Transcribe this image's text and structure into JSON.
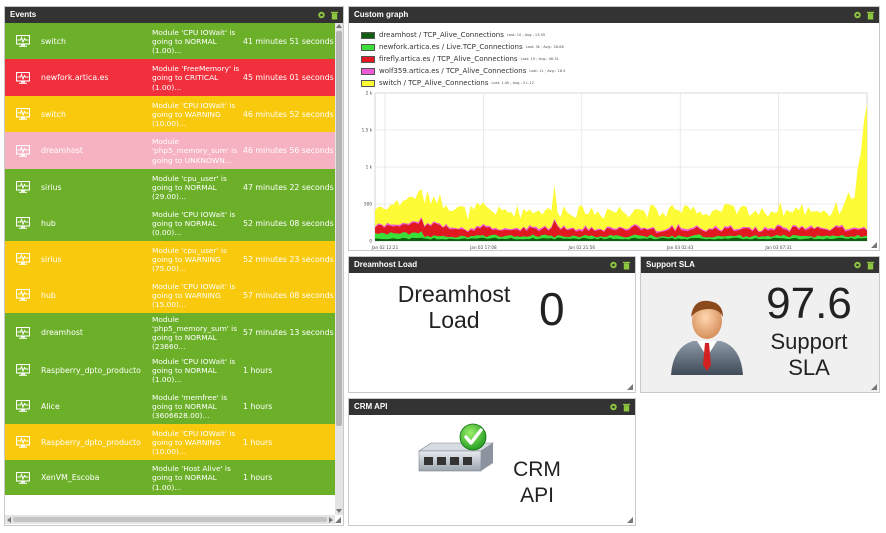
{
  "events": {
    "title": "Events",
    "rows": [
      {
        "agent": "switch",
        "message": "Module 'CPU IOWait' is going to NORMAL (1.00)...",
        "time": "41 minutes 51 seconds",
        "status": "normal"
      },
      {
        "agent": "newfork.artica.es",
        "message": "Module 'FreeMemory' is going to CRITICAL (1.00)...",
        "time": "45 minutes 01 seconds",
        "status": "critical"
      },
      {
        "agent": "switch",
        "message": "Module 'CPU IOWait' is going to WARNING (10.00)...",
        "time": "46 minutes 52 seconds",
        "status": "warning"
      },
      {
        "agent": "dreamhost",
        "message": "Module 'php5_memory_sum' is going to UNKNOWN...",
        "time": "46 minutes 56 seconds",
        "status": "unknown"
      },
      {
        "agent": "sirius",
        "message": "Module 'cpu_user' is going to NORMAL (29.00)...",
        "time": "47 minutes 22 seconds",
        "status": "normal"
      },
      {
        "agent": "hub",
        "message": "Module 'CPU IOWait' is going to NORMAL (0.00)...",
        "time": "52 minutes 08 seconds",
        "status": "normal"
      },
      {
        "agent": "sirius",
        "message": "Module 'cpu_user' is going to WARNING (75.00)...",
        "time": "52 minutes 23 seconds",
        "status": "warning"
      },
      {
        "agent": "hub",
        "message": "Module 'CPU IOWait' is going to WARNING (15.00)...",
        "time": "57 minutes 08 seconds",
        "status": "warning"
      },
      {
        "agent": "dreamhost",
        "message": "Module 'php5_memory_sum' is going to NORMAL (23660...",
        "time": "57 minutes 13 seconds",
        "status": "normal"
      },
      {
        "agent": "Raspberry_dpto_producto",
        "message": "Module 'CPU IOWait' is going to NORMAL (1.00)...",
        "time": "1 hours",
        "status": "normal"
      },
      {
        "agent": "Alice",
        "message": "Module 'memfree' is going to NORMAL (3606628.00)...",
        "time": "1 hours",
        "status": "normal"
      },
      {
        "agent": "Raspberry_dpto_producto",
        "message": "Module 'CPU IOWait' is going to WARNING (10.00)...",
        "time": "1 hours",
        "status": "warning"
      },
      {
        "agent": "XenVM_Escoba",
        "message": "Module 'Host Alive' is going to NORMAL (1.00)...",
        "time": "1 hours",
        "status": "normal"
      }
    ]
  },
  "status_colors": {
    "normal": "#6cb02a",
    "critical": "#f2303d",
    "warning": "#f8c90c",
    "unknown": "#f7b2c2"
  },
  "icons": {
    "panel_config": "gear-icon",
    "panel_delete": "trash-icon",
    "event_agent": "monitor-heartbeat-icon"
  },
  "custom_graph": {
    "title": "Custom graph"
  },
  "chart_data": {
    "type": "area",
    "stacked": true,
    "series": [
      {
        "name": "dreamhost / TCP_Alive_Connections",
        "stats": "Last: 10 ; Avg.: 13.95",
        "color": "#115e11"
      },
      {
        "name": "newfork.artica.es / Live.TCP_Connections",
        "stats": "Last: 3k ; Avg.: 28.68",
        "color": "#3adf3a"
      },
      {
        "name": "firefly.artica.es / TCP_Alive_Connections",
        "stats": "Last: 19 ; Avg.: 46.31",
        "color": "#e1181f"
      },
      {
        "name": "wolf359.artica.es / TCP_Alive_Connections",
        "stats": "Last: 11 ; Avg.: 16.5",
        "color": "#ee5ad6"
      },
      {
        "name": "switch / TCP_Alive_Connections",
        "stats": "Last: 1.4k ; Avg.: 3 L.12",
        "color": "#fcfb35"
      }
    ],
    "y_ticks": [
      "2 k",
      "1.5 k",
      "1 k",
      "500",
      "0"
    ],
    "x_ticks": [
      "Jan 02 12:21",
      "Jan 02 17:08",
      "Jan 02 21:56",
      "Jan 03 02:43",
      "Jan 03 07:31"
    ],
    "ylim": [
      0,
      2000
    ],
    "grid": true
  },
  "dreamhost_load": {
    "title": "Dreamhost Load",
    "label": "Dreamhost Load",
    "value": "0"
  },
  "support_sla": {
    "title": "Support SLA",
    "value": "97.6",
    "label": "Support SLA"
  },
  "crm_api": {
    "title": "CRM API",
    "label": "CRM API"
  }
}
